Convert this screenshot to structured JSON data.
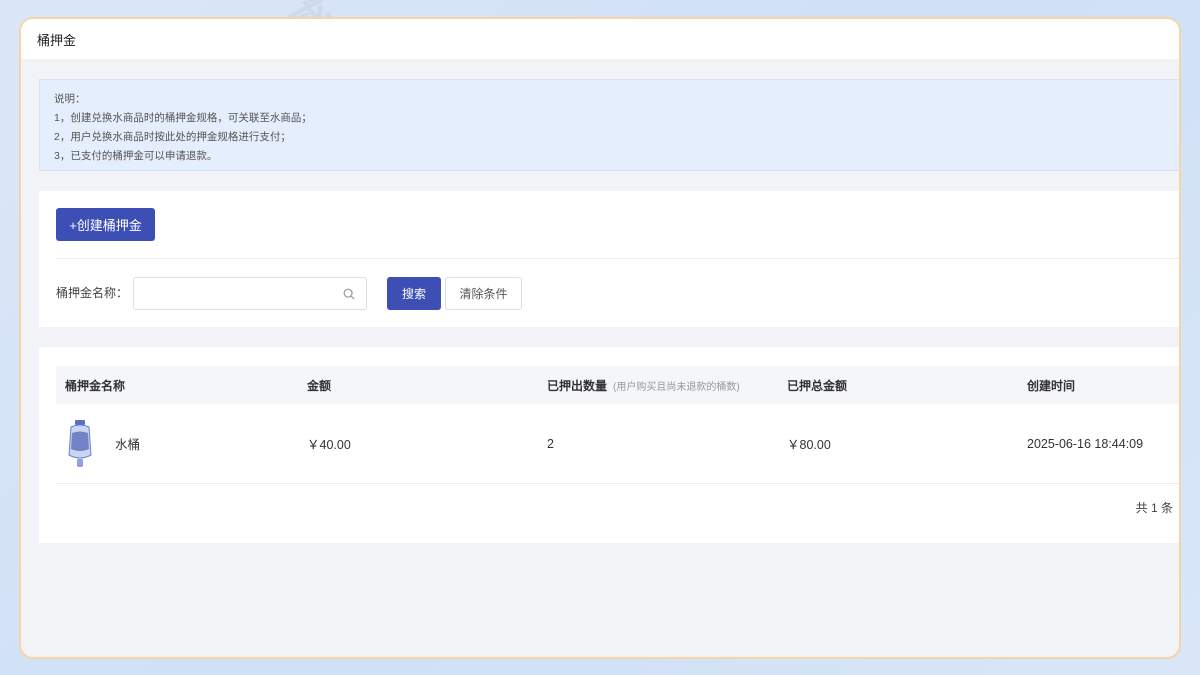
{
  "title": "桶押金",
  "notice": {
    "heading": "说明：",
    "lines": [
      "1，创建兑换水商品时的桶押金规格，可关联至水商品；",
      "2，用户兑换水商品时按此处的押金规格进行支付；",
      "3，已支付的桶押金可以申请退款。"
    ]
  },
  "toolbar": {
    "create_label": "+创建桶押金",
    "filter_label": "桶押金名称：",
    "search_placeholder": "",
    "search_label": "搜索",
    "clear_label": "清除条件"
  },
  "table": {
    "columns": [
      "桶押金名称",
      "金额",
      "已押出数量",
      "已押总金额",
      "创建时间"
    ],
    "quantity_hint": "(用户购买且尚未退款的桶数)",
    "rows": [
      {
        "name": "水桶",
        "amount": "￥40.00",
        "quantity": "2",
        "total_amount": "￥80.00",
        "created_at": "2025-06-16 18:44:09"
      }
    ],
    "total_text": "共 1 条"
  },
  "watermark": "编界感",
  "colors": {
    "primary": "#3d4fb5",
    "frame_border": "#f7d3a8",
    "notice_bg": "#e5eefc"
  }
}
